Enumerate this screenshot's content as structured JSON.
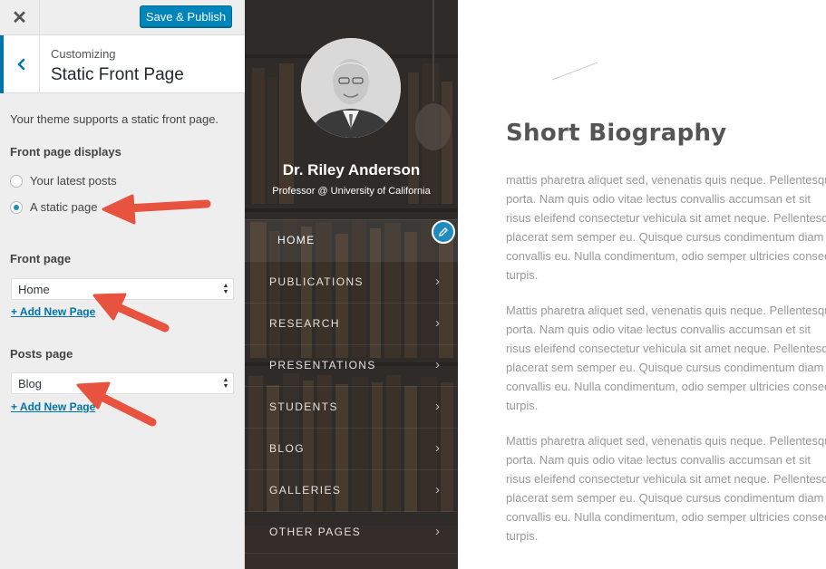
{
  "customizer": {
    "close_label": "✕",
    "publish_label": "Save & Publish",
    "section_subtitle": "Customizing",
    "section_title": "Static Front Page",
    "description": "Your theme supports a static front page.",
    "front_page_displays_label": "Front page displays",
    "radio_latest": "Your latest posts",
    "radio_static": "A static page",
    "front_page_label": "Front page",
    "front_page_value": "Home",
    "posts_page_label": "Posts page",
    "posts_page_value": "Blog",
    "add_new_page": "+ Add New Page",
    "selected_option": "A static page"
  },
  "sidebar": {
    "name": "Dr. Riley Anderson",
    "role": "Professor @ University of California",
    "active_item": "HOME",
    "nav": [
      "HOME",
      "PUBLICATIONS",
      "RESEARCH",
      "PRESENTATIONS",
      "STUDENTS",
      "BLOG",
      "GALLERIES",
      "OTHER PAGES"
    ]
  },
  "content": {
    "title": "Short Biography",
    "paragraphs": [
      [
        "mattis pharetra aliquet sed, venenatis quis neque. Pellentesque",
        "porta. Nam quis odio vitae lectus convallis accumsan et sit",
        "risus eleifend consectetur vehicula sit amet neque. Pellentesque",
        "placerat sem semper eu. Quisque cursus condimentum diam",
        "convallis eu. Nulla condimentum, odio semper ultricies consequat",
        "turpis."
      ],
      [
        "Mattis pharetra aliquet sed, venenatis quis neque. Pellentesque",
        "porta. Nam quis odio vitae lectus convallis accumsan et sit",
        "risus eleifend consectetur vehicula sit amet neque. Pellentesque",
        "placerat sem semper eu. Quisque cursus condimentum diam",
        "convallis eu. Nulla condimentum, odio semper ultricies consequat",
        "turpis."
      ],
      [
        "Mattis pharetra aliquet sed, venenatis quis neque. Pellentesque",
        "porta. Nam quis odio vitae lectus convallis accumsan et sit",
        "risus eleifend consectetur vehicula sit amet neque. Pellentesque",
        "placerat sem semper eu. Quisque cursus condimentum diam",
        "convallis eu. Nulla condimentum, odio semper ultricies consequat",
        "turpis."
      ]
    ]
  },
  "colors": {
    "accent": "#0085ba",
    "sidebar_bg": "#34302d",
    "arrow": "#e8533f"
  }
}
